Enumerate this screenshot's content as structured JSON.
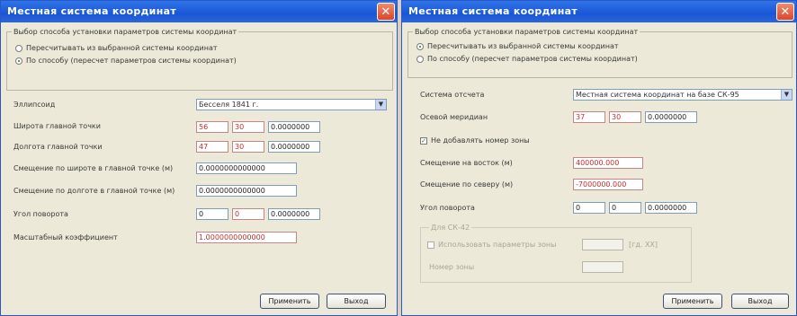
{
  "left": {
    "title": "Местная система координат",
    "close_icon": "✕",
    "group_caption": "Выбор способа установки параметров системы координат",
    "radio1": "Пересчитывать из выбранной системы координат",
    "radio2": "По способу (пересчет параметров системы координат)",
    "ellipsoid_label": "Эллипсоид",
    "ellipsoid_value": "Бесселя 1841 г.",
    "lat_label": "Широта главной точки",
    "lat_deg": "56",
    "lat_min": "30",
    "lat_sec": "0.0000000",
    "lon_label": "Долгота главной точки",
    "lon_deg": "47",
    "lon_min": "30",
    "lon_sec": "0.0000000",
    "shift_lat_label": "Смещение по широте в главной точке (м)",
    "shift_lat_value": "0.0000000000000",
    "shift_lon_label": "Смещение по долготе в главной точке (м)",
    "shift_lon_value": "0.0000000000000",
    "rot_label": "Угол поворота",
    "rot_deg": "0",
    "rot_min": "0",
    "rot_sec": "0.0000000",
    "scale_label": "Масштабный коэффициент",
    "scale_value": "1.0000000000000",
    "apply_button": "Применить",
    "exit_button": "Выход"
  },
  "right": {
    "title": "Местная система координат",
    "close_icon": "✕",
    "group_caption": "Выбор способа установки параметров системы координат",
    "radio1": "Пересчитывать из выбранной системы координат",
    "radio2": "По способу (пересчет параметров системы координат)",
    "system_label": "Система отсчета",
    "system_value": "Местная система координат на базе СК-95",
    "merid_label": "Осевой меридиан",
    "merid_deg": "37",
    "merid_min": "30",
    "merid_sec": "0.0000000",
    "zone_check_label": "Не добавлять номер зоны",
    "east_label": "Смещение на восток (м)",
    "east_value": "400000.000",
    "north_label": "Смещение по северу (м)",
    "north_value": "-7000000.000",
    "rot_label": "Угол поворота",
    "rot_deg": "0",
    "rot_min": "0",
    "rot_sec": "0.0000000",
    "sk42_caption": "Для СК-42",
    "sk42_check_label": "Использовать параметры зоны",
    "sk42_unit": "[гд. ХХ]",
    "sk42_second_label": "Номер зоны",
    "apply_button": "Применить",
    "exit_button": "Выход"
  }
}
